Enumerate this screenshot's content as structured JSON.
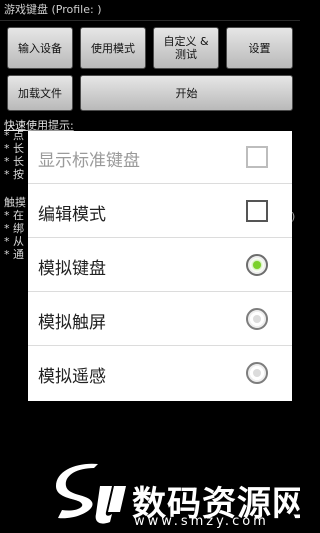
{
  "title_bar": {
    "text": "游戏键盘 (Profile: )"
  },
  "toolbar": {
    "input_device": "输入设备",
    "use_mode": "使用模式",
    "custom_test": "自定义 &\n测试",
    "settings": "设置",
    "load_file": "加载文件",
    "start": "开始"
  },
  "background": {
    "hint_title": "快速使用提示:",
    "lines": [
      "* 点",
      "* 长",
      "* 长",
      "* 按",
      "触摸",
      "* 在",
      "* 绑",
      "* 从",
      "* 通"
    ],
    "right_fragment": "后)"
  },
  "dialog": {
    "items": [
      {
        "label": "显示标准键盘",
        "control": "checkbox",
        "checked": false,
        "enabled": false
      },
      {
        "label": "编辑模式",
        "control": "checkbox",
        "checked": false,
        "enabled": true
      },
      {
        "label": "模拟键盘",
        "control": "radio",
        "selected": true,
        "enabled": true
      },
      {
        "label": "模拟触屏",
        "control": "radio",
        "selected": false,
        "enabled": true
      },
      {
        "label": "模拟遥感",
        "control": "radio",
        "selected": false,
        "enabled": true
      }
    ]
  },
  "watermark": {
    "brand": "数码资源网",
    "url": "www.smzy.com"
  },
  "colors": {
    "radio_selected": "#7bd12a",
    "background": "#000000",
    "dialog": "#ffffff"
  }
}
